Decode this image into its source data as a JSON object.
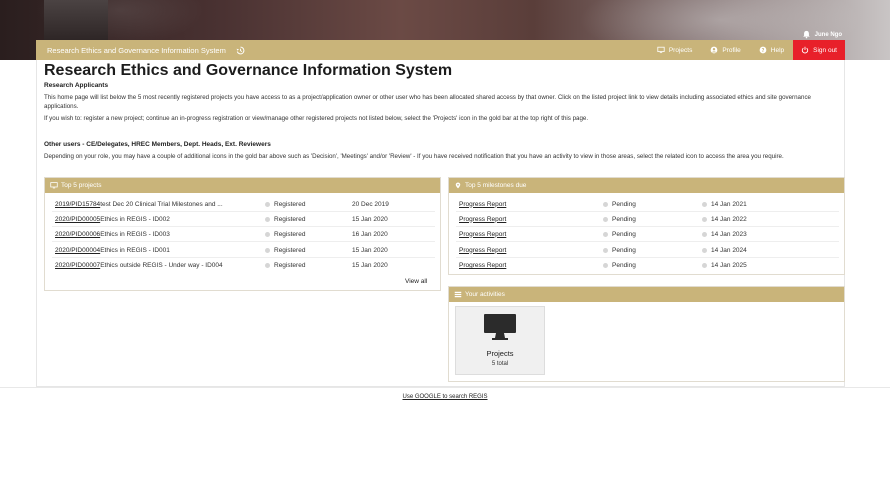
{
  "header": {
    "user": "June Ngo",
    "brand": "Research Ethics and Governance Information System",
    "nav": {
      "projects": "Projects",
      "profile": "Profile",
      "help": "Help",
      "signout": "Sign out"
    }
  },
  "page": {
    "title": "Research Ethics and Governance Information System",
    "section1": "Research Applicants",
    "para1": "This home page will list below the 5 most recently registered projects you have access to as a project/application owner or other user who has been allocated shared access by that owner. Click on the listed project link to view details including associated ethics and site governance applications.",
    "para2": "If you wish to: register a new project; continue an in-progress registration or view/manage other registered projects not listed below, select the 'Projects' icon in the gold bar at the top right of this page.",
    "section2": "Other users - CE/Delegates, HREC Members, Dept. Heads, Ext. Reviewers",
    "para3": "Depending on your role, you may have a couple of additional icons in the gold bar above such as 'Decision', 'Meetings' and/or 'Review' - If you have received notification that you have an activity to view in those areas, select the related icon to access the area you require."
  },
  "top_projects": {
    "title": "Top 5 projects",
    "rows": [
      {
        "id": "2019/PID15784",
        "name": " test Dec 20 Clinical Trial Milestones and ...",
        "status": "Registered",
        "date": "20 Dec 2019"
      },
      {
        "id": "2020/PID00005",
        "name": " Ethics in REGIS - ID002",
        "status": "Registered",
        "date": "15 Jan 2020"
      },
      {
        "id": "2020/PID00006",
        "name": " Ethics in REGIS - ID003",
        "status": "Registered",
        "date": "16 Jan 2020"
      },
      {
        "id": "2020/PID00004",
        "name": " Ethics in REGIS - ID001",
        "status": "Registered",
        "date": "15 Jan 2020"
      },
      {
        "id": "2020/PID00007",
        "name": " Ethics outside REGIS - Under way - ID004",
        "status": "Registered",
        "date": "15 Jan 2020"
      }
    ],
    "view_all": "View all"
  },
  "milestones": {
    "title": "Top 5 milestones due",
    "rows": [
      {
        "name": "Progress Report",
        "status": "Pending",
        "date": "14 Jan 2021"
      },
      {
        "name": "Progress Report",
        "status": "Pending",
        "date": "14 Jan 2022"
      },
      {
        "name": "Progress Report",
        "status": "Pending",
        "date": "14 Jan 2023"
      },
      {
        "name": "Progress Report",
        "status": "Pending",
        "date": "14 Jan 2024"
      },
      {
        "name": "Progress Report",
        "status": "Pending",
        "date": "14 Jan 2025"
      }
    ]
  },
  "activities": {
    "title": "Your activities",
    "tile_label": "Projects",
    "tile_count": "5 total"
  },
  "footer": {
    "link": "Use GOOGLE to search REGIS"
  },
  "colors": {
    "gold": "#c9b47a",
    "signout": "#e8202a"
  }
}
